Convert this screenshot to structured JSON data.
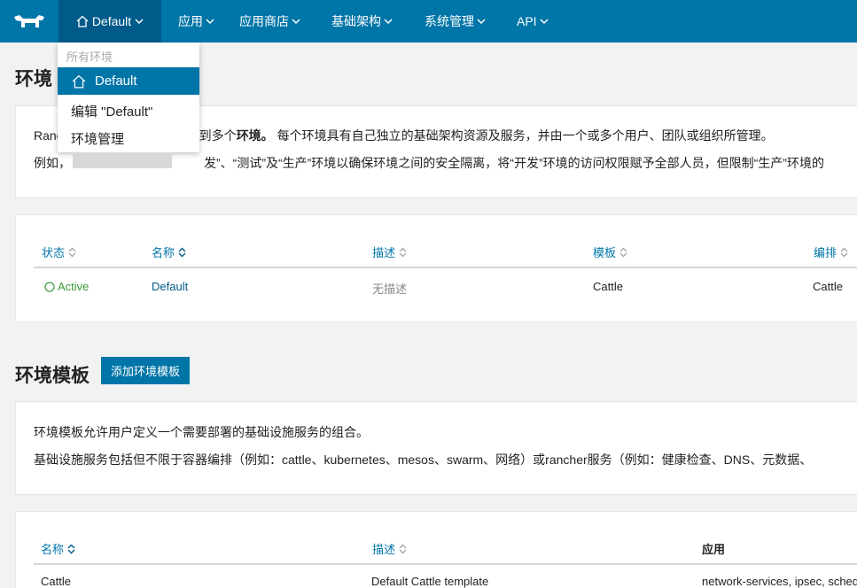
{
  "nav": {
    "environment": "Default",
    "items": [
      "应用",
      "应用商店",
      "基础架构",
      "系统管理",
      "API"
    ]
  },
  "dropdown": {
    "header": "所有环境",
    "active": "Default",
    "edit": "编辑 \"Default\"",
    "manage": "环境管理"
  },
  "environments": {
    "title": "环境",
    "desc1_prefix": "Ranc",
    "desc1_rest": "置到多个",
    "desc1_bold": "环境。",
    "desc1_tail": "每个环境具有自己独立的基础架构资源及服务，并由一个或多个用户、团队或组织所管理。",
    "desc2_prefix": "例如，",
    "desc2_tail": "发”、“测试”及“生产”环境以确保环境之间的安全隔离，将“开发”环境的访问权限赋予全部人员，但限制“生产”环境的",
    "table": {
      "headers": [
        "状态",
        "名称",
        "描述",
        "模板",
        "编排"
      ],
      "row": {
        "status": "Active",
        "name": "Default",
        "desc": "无描述",
        "template": "Cattle",
        "orchestration": "Cattle"
      }
    }
  },
  "templates": {
    "title": "环境模板",
    "add_button": "添加环境模板",
    "desc1": "环境模板允许用户定义一个需要部署的基础设施服务的组合。",
    "desc2": "基础设施服务包括但不限于容器编排（例如：cattle、kubernetes、mesos、swarm、网络）或rancher服务（例如：健康检查、DNS、元数据、",
    "table": {
      "headers": [
        "名称",
        "描述",
        "应用"
      ],
      "row": {
        "name": "Cattle",
        "desc": "Default Cattle template",
        "apps": "network-services, ipsec, schedu"
      }
    }
  },
  "colors": {
    "nav": "#0075a8",
    "nav_active": "#005a8a",
    "active_green": "#3c9a3c"
  }
}
